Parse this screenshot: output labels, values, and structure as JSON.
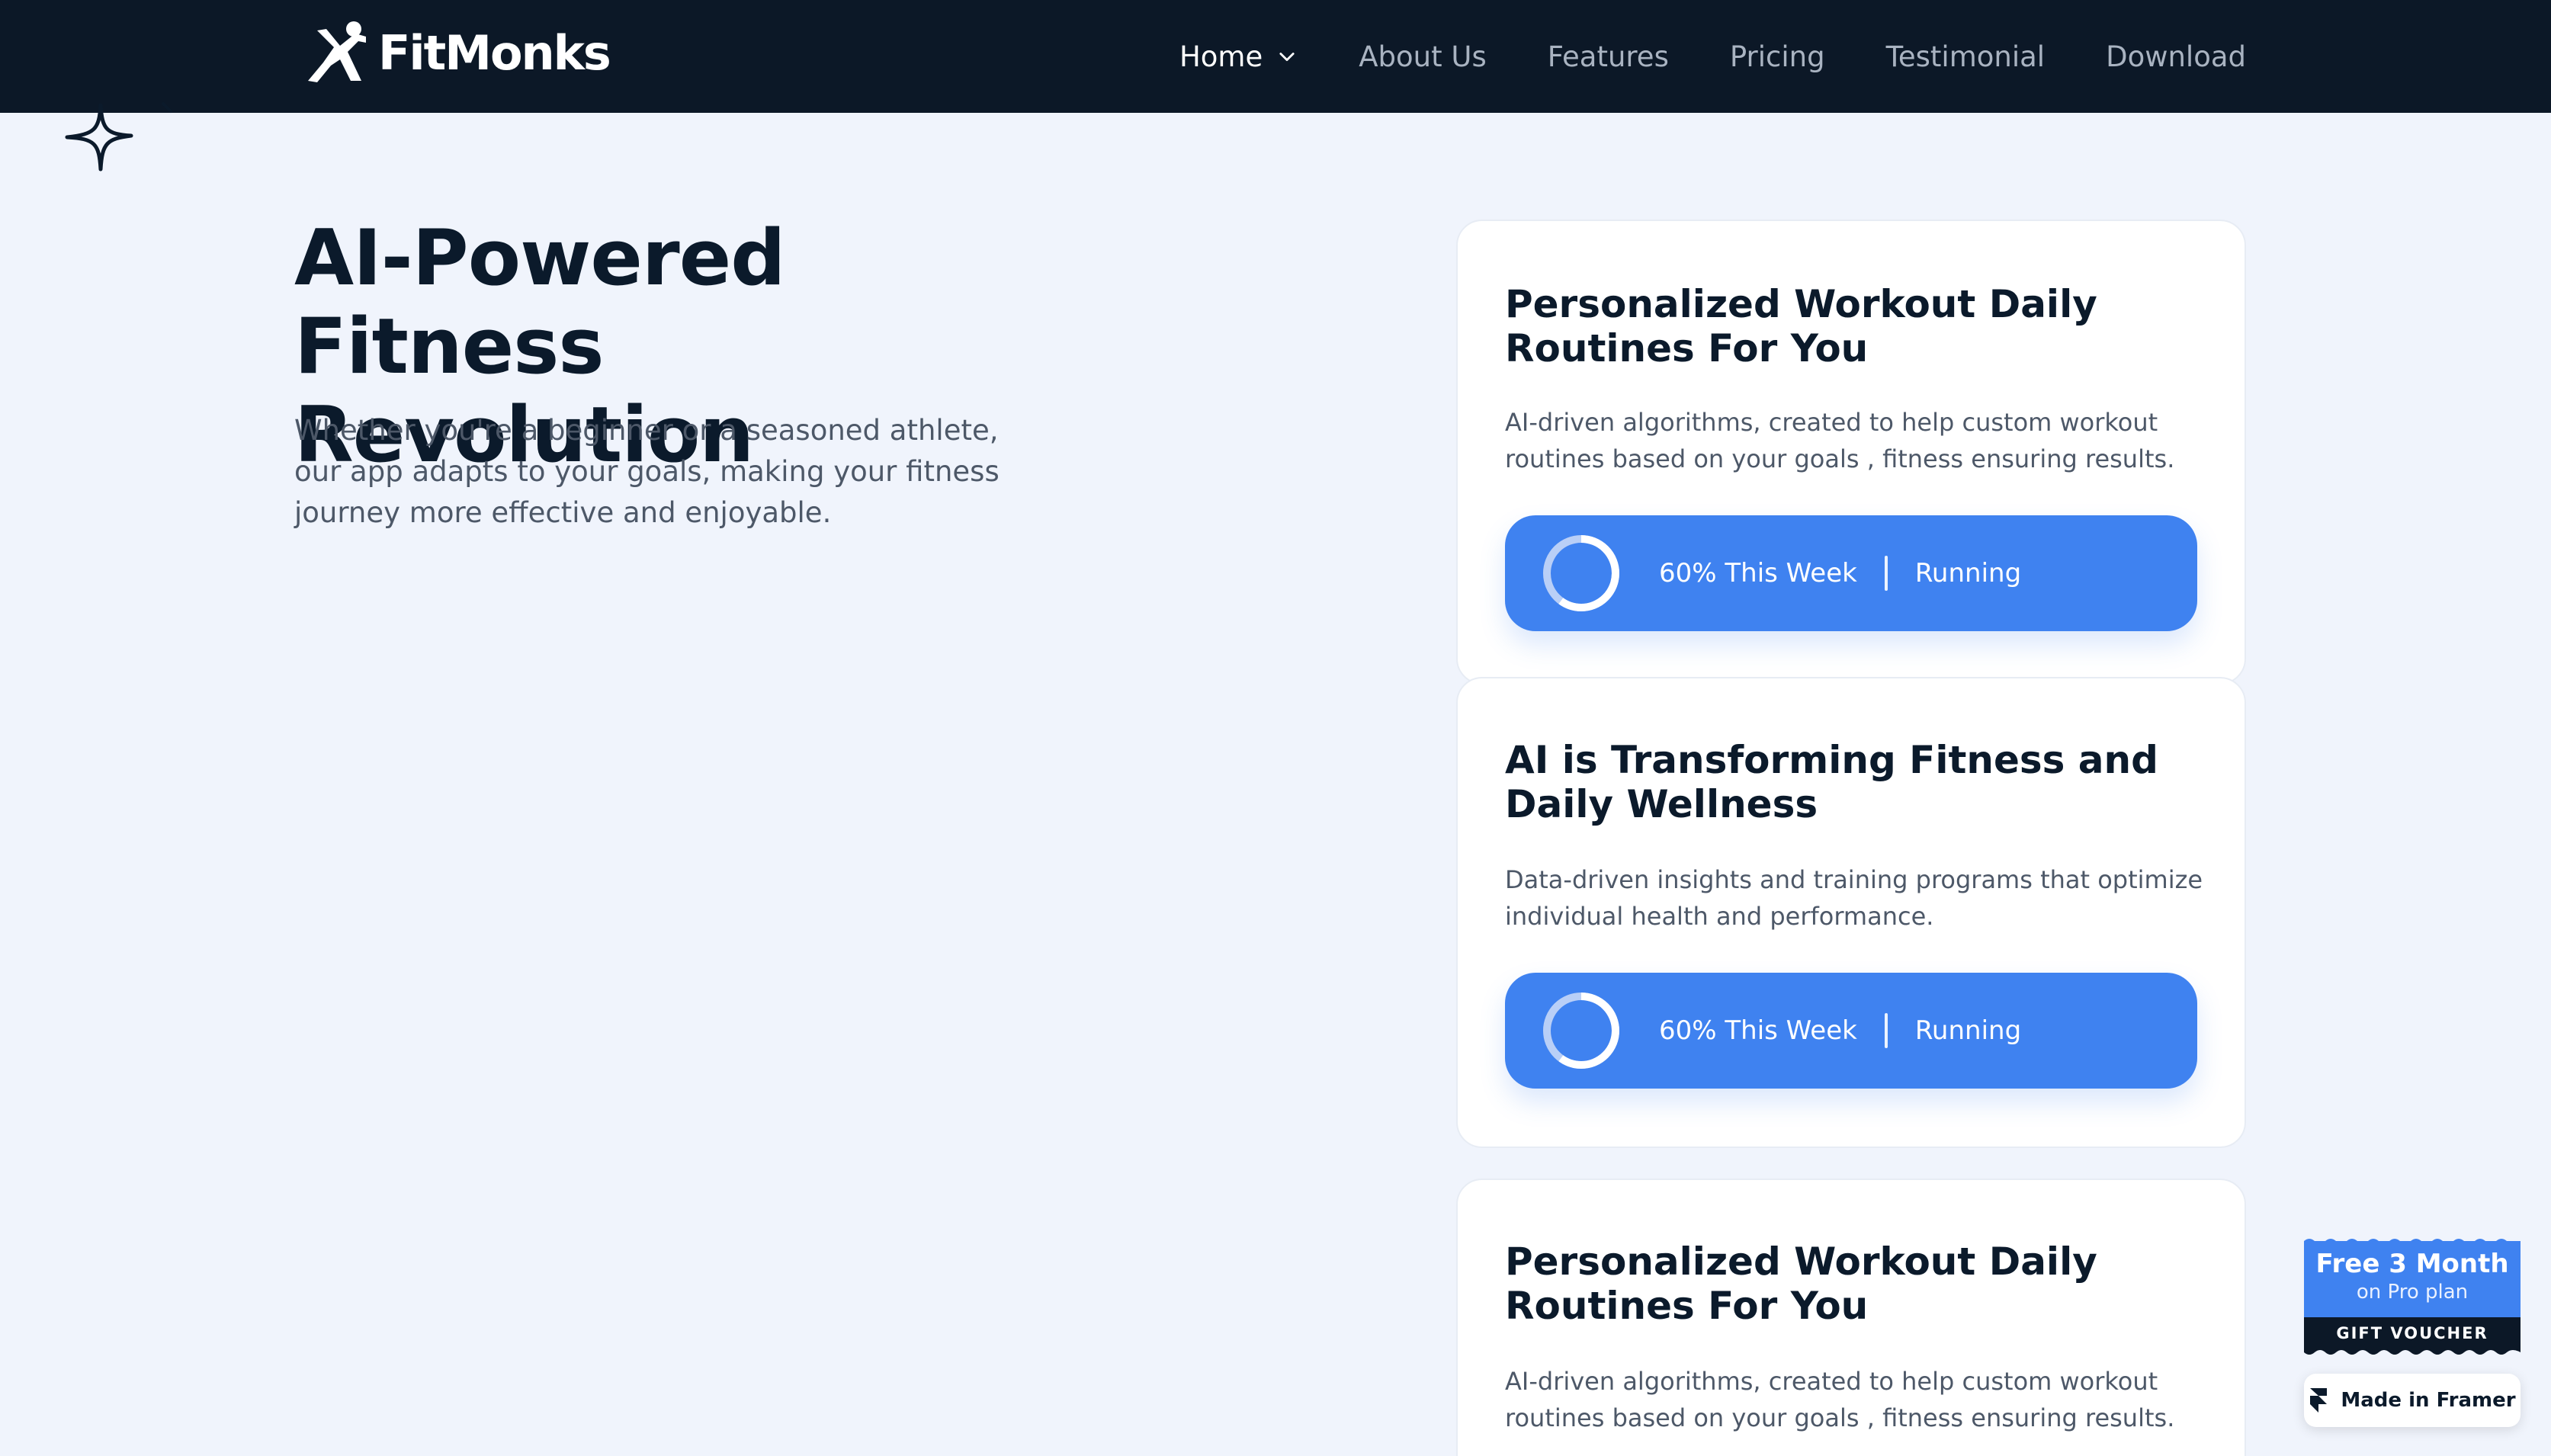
{
  "brand": {
    "name": "FitMonks"
  },
  "nav": {
    "items": [
      {
        "label": "Home",
        "active": true,
        "has_dropdown": true
      },
      {
        "label": "About Us"
      },
      {
        "label": "Features"
      },
      {
        "label": "Pricing"
      },
      {
        "label": "Testimonial"
      },
      {
        "label": "Download"
      }
    ]
  },
  "hero": {
    "title_line1": "AI-Powered",
    "title_line2": "Fitness Revolution",
    "subtitle": "Whether you're a beginner or a seasoned athlete, our app adapts to your goals, making your fitness journey more effective and enjoyable."
  },
  "cards": [
    {
      "title": "Personalized Workout Daily Routines For You",
      "description": "AI-driven algorithms, created to help custom workout routines based on your goals , fitness ensuring results.",
      "progress_label": "60% This Week",
      "progress_fraction": 0.6,
      "activity": "Running"
    },
    {
      "title": "AI is Transforming Fitness and Daily Wellness",
      "description": "Data-driven insights and training programs that optimize individual health and performance.",
      "progress_label": "60% This Week",
      "progress_fraction": 0.6,
      "activity": "Running"
    },
    {
      "title": "Personalized Workout Daily Routines For You",
      "description": "AI-driven algorithms, created to help custom workout routines based on your goals , fitness ensuring results."
    }
  ],
  "voucher": {
    "title": "Free 3 Month",
    "subtitle": "on Pro plan",
    "tag": "GIFT VOUCHER"
  },
  "framer_badge": {
    "label": "Made in Framer"
  },
  "colors": {
    "nav_bg": "#0c1827",
    "page_bg": "#f0f4fc",
    "accent_blue": "#3f82f0",
    "heading": "#0b1a2b",
    "body_text": "#4d5868"
  },
  "icons": {
    "logo": "running-figure-icon",
    "nav_dropdown": "chevron-down-icon",
    "decor": "sparkle-icon",
    "progress": "progress-ring-icon",
    "framer": "framer-logo-icon"
  }
}
